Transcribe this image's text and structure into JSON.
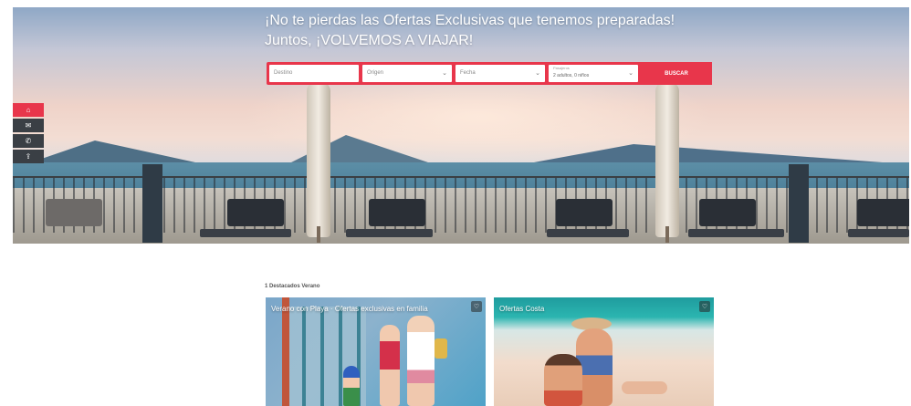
{
  "hero": {
    "title": "¡No te pierdas las Ofertas Exclusivas que tenemos preparadas! Juntos, ¡VOLVEMOS A VIAJAR!"
  },
  "search": {
    "destination_placeholder": "Destino",
    "origin_placeholder": "Origen",
    "date_placeholder": "Fecha",
    "passengers_label": "Pasajeros",
    "passengers_value": "2 adultos, 0 niños",
    "button_label": "BUSCAR"
  },
  "side_widget": {
    "items": [
      {
        "icon": "home-icon",
        "glyph": "⌂"
      },
      {
        "icon": "mail-icon",
        "glyph": "✉"
      },
      {
        "icon": "phone-icon",
        "glyph": "✆"
      },
      {
        "icon": "share-icon",
        "glyph": "⇪"
      }
    ]
  },
  "section": {
    "title": "1 Destacados Verano",
    "cards": [
      {
        "caption": "Verano con Playa · Ofertas exclusivas en familia",
        "corner_glyph": "♡"
      },
      {
        "caption": "Ofertas Costa",
        "corner_glyph": "♡"
      }
    ]
  },
  "colors": {
    "accent": "#e8364b",
    "side_dark": "#3a3f45"
  }
}
